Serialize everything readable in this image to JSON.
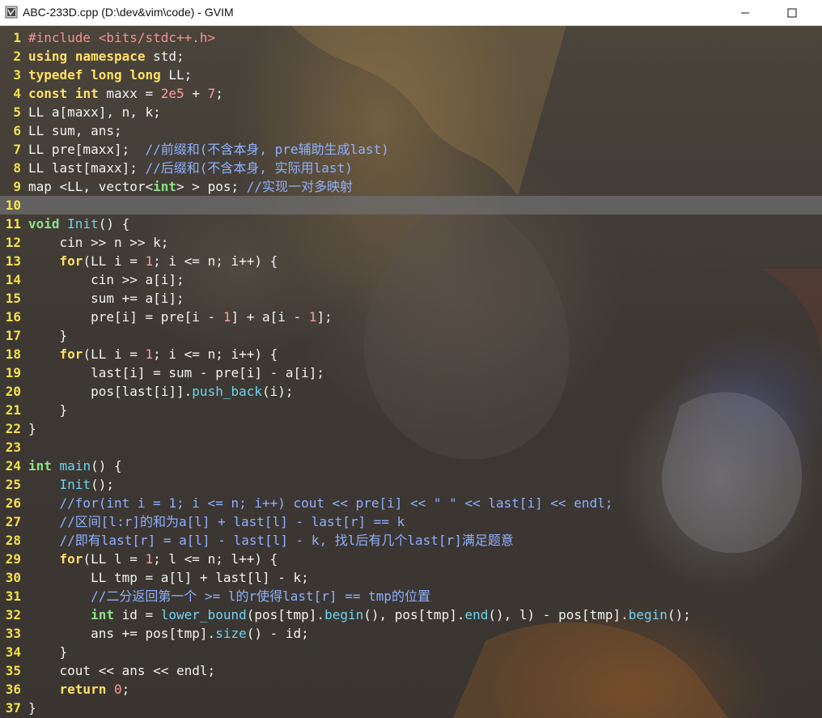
{
  "window": {
    "title": "ABC-233D.cpp (D:\\dev&vim\\code) - GVIM",
    "minimize_glyph": "—",
    "maximize_glyph": "☐"
  },
  "editor": {
    "current_line": 10,
    "lines": [
      [
        [
          "pp",
          "#include <bits/stdc++.h>"
        ]
      ],
      [
        [
          "kw",
          "using"
        ],
        [
          "plain",
          " "
        ],
        [
          "kw",
          "namespace"
        ],
        [
          "plain",
          " std;"
        ]
      ],
      [
        [
          "kw",
          "typedef"
        ],
        [
          "plain",
          " "
        ],
        [
          "kw",
          "long"
        ],
        [
          "plain",
          " "
        ],
        [
          "kw",
          "long"
        ],
        [
          "plain",
          " LL;"
        ]
      ],
      [
        [
          "kw",
          "const"
        ],
        [
          "plain",
          " "
        ],
        [
          "kw",
          "int"
        ],
        [
          "plain",
          " maxx = "
        ],
        [
          "num",
          "2e5"
        ],
        [
          "plain",
          " + "
        ],
        [
          "num",
          "7"
        ],
        [
          "plain",
          ";"
        ]
      ],
      [
        [
          "plain",
          "LL a[maxx], n, k;"
        ]
      ],
      [
        [
          "plain",
          "LL sum, ans;"
        ]
      ],
      [
        [
          "plain",
          "LL pre[maxx];  "
        ],
        [
          "cmt",
          "//前缀和(不含本身, pre辅助生成last)"
        ]
      ],
      [
        [
          "plain",
          "LL last[maxx]; "
        ],
        [
          "cmt",
          "//后缀和(不含本身, 实际用last)"
        ]
      ],
      [
        [
          "plain",
          "map <LL, vector<"
        ],
        [
          "type",
          "int"
        ],
        [
          "plain",
          "> > pos; "
        ],
        [
          "cmt",
          "//实现一对多映射"
        ]
      ],
      [],
      [
        [
          "type",
          "void"
        ],
        [
          "plain",
          " "
        ],
        [
          "fn",
          "Init"
        ],
        [
          "plain",
          "() {"
        ]
      ],
      [
        [
          "plain",
          "    cin >> n >> k;"
        ]
      ],
      [
        [
          "plain",
          "    "
        ],
        [
          "kw",
          "for"
        ],
        [
          "plain",
          "(LL i = "
        ],
        [
          "num",
          "1"
        ],
        [
          "plain",
          "; i <= n; i++) {"
        ]
      ],
      [
        [
          "plain",
          "        cin >> a[i];"
        ]
      ],
      [
        [
          "plain",
          "        sum += a[i];"
        ]
      ],
      [
        [
          "plain",
          "        pre[i] = pre[i - "
        ],
        [
          "num",
          "1"
        ],
        [
          "plain",
          "] + a[i - "
        ],
        [
          "num",
          "1"
        ],
        [
          "plain",
          "];"
        ]
      ],
      [
        [
          "plain",
          "    }"
        ]
      ],
      [
        [
          "plain",
          "    "
        ],
        [
          "kw",
          "for"
        ],
        [
          "plain",
          "(LL i = "
        ],
        [
          "num",
          "1"
        ],
        [
          "plain",
          "; i <= n; i++) {"
        ]
      ],
      [
        [
          "plain",
          "        last[i] = sum - pre[i] - a[i];"
        ]
      ],
      [
        [
          "plain",
          "        pos[last[i]]."
        ],
        [
          "fn",
          "push_back"
        ],
        [
          "plain",
          "(i);"
        ]
      ],
      [
        [
          "plain",
          "    }"
        ]
      ],
      [
        [
          "plain",
          "}"
        ]
      ],
      [],
      [
        [
          "type",
          "int"
        ],
        [
          "plain",
          " "
        ],
        [
          "fn",
          "main"
        ],
        [
          "plain",
          "() {"
        ]
      ],
      [
        [
          "plain",
          "    "
        ],
        [
          "fn",
          "Init"
        ],
        [
          "plain",
          "();"
        ]
      ],
      [
        [
          "plain",
          "    "
        ],
        [
          "cmt",
          "//for(int i = 1; i <= n; i++) cout << pre[i] << \" \" << last[i] << endl;"
        ]
      ],
      [
        [
          "plain",
          "    "
        ],
        [
          "cmt",
          "//区间[l:r]的和为a[l] + last[l] - last[r] == k"
        ]
      ],
      [
        [
          "plain",
          "    "
        ],
        [
          "cmt",
          "//即有last[r] = a[l] - last[l] - k, 找l后有几个last[r]满足题意"
        ]
      ],
      [
        [
          "plain",
          "    "
        ],
        [
          "kw",
          "for"
        ],
        [
          "plain",
          "(LL l = "
        ],
        [
          "num",
          "1"
        ],
        [
          "plain",
          "; l <= n; l++) {"
        ]
      ],
      [
        [
          "plain",
          "        LL tmp = a[l] + last[l] - k;"
        ]
      ],
      [
        [
          "plain",
          "        "
        ],
        [
          "cmt",
          "//二分返回第一个 >= l的r使得last[r] == tmp的位置"
        ]
      ],
      [
        [
          "plain",
          "        "
        ],
        [
          "type",
          "int"
        ],
        [
          "plain",
          " id = "
        ],
        [
          "fn",
          "lower_bound"
        ],
        [
          "plain",
          "(pos[tmp]."
        ],
        [
          "fn",
          "begin"
        ],
        [
          "plain",
          "(), pos[tmp]."
        ],
        [
          "fn",
          "end"
        ],
        [
          "plain",
          "(), l) - pos[tmp]."
        ],
        [
          "fn",
          "begin"
        ],
        [
          "plain",
          "();"
        ]
      ],
      [
        [
          "plain",
          "        ans += pos[tmp]."
        ],
        [
          "fn",
          "size"
        ],
        [
          "plain",
          "() - id;"
        ]
      ],
      [
        [
          "plain",
          "    }"
        ]
      ],
      [
        [
          "plain",
          "    cout << ans << endl;"
        ]
      ],
      [
        [
          "plain",
          "    "
        ],
        [
          "kw",
          "return"
        ],
        [
          "plain",
          " "
        ],
        [
          "num",
          "0"
        ],
        [
          "plain",
          ";"
        ]
      ],
      [
        [
          "plain",
          "}"
        ]
      ]
    ]
  }
}
